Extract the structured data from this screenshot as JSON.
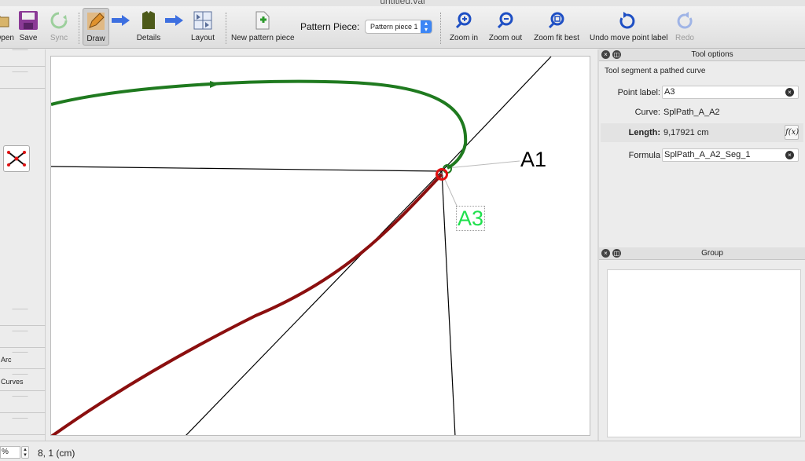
{
  "window": {
    "title": "untitled.val"
  },
  "toolbar": {
    "open_label": "Open",
    "save_label": "Save",
    "sync_label": "Sync",
    "draw_label": "Draw",
    "details_label": "Details",
    "layout_label": "Layout",
    "new_pattern_piece_label": "New pattern piece",
    "pattern_piece_label": "Pattern Piece:",
    "pattern_piece_value": "Pattern piece 1",
    "zoom_in_label": "Zoom in",
    "zoom_out_label": "Zoom out",
    "zoom_fit_best_label": "Zoom fit best",
    "undo_move_label": "Undo move point label",
    "redo_label": "Redo"
  },
  "left_panel": {
    "items": [
      "",
      "",
      "",
      "",
      "",
      "Arc",
      "Curves",
      "",
      ""
    ]
  },
  "canvas": {
    "labels": {
      "a1": "A1",
      "a3": "A3"
    },
    "colors": {
      "curve_green": "#1f7a1f",
      "curve_red": "#8b0f0f",
      "point_red": "#e01010",
      "label_green": "#1ee04c"
    }
  },
  "tool_options": {
    "panel_title": "Tool options",
    "tool_title": "Tool segment a pathed curve",
    "point_label_key": "Point label:",
    "point_label_value": "A3",
    "curve_key": "Curve:",
    "curve_value": "SplPath_A_A2",
    "length_key": "Length:",
    "length_value": "9,17921 cm",
    "formula_key": "Formula",
    "formula_value": "SplPath_A_A2_Seg_1"
  },
  "group": {
    "panel_title": "Group"
  },
  "statusbar": {
    "zoom": "%",
    "coords": "8, 1 (cm)"
  }
}
